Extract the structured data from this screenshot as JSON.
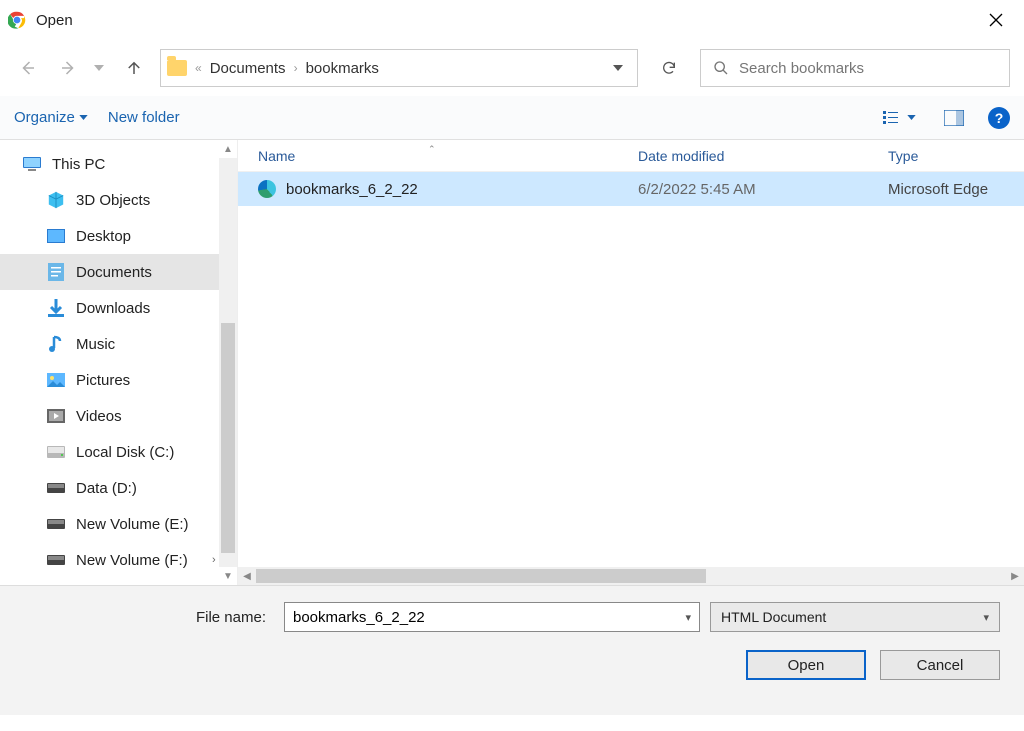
{
  "window": {
    "title": "Open"
  },
  "nav": {
    "segments": [
      "Documents",
      "bookmarks"
    ]
  },
  "search": {
    "placeholder": "Search bookmarks"
  },
  "toolbar": {
    "organize": "Organize",
    "new_folder": "New folder"
  },
  "sidebar": {
    "root": "This PC",
    "items": [
      {
        "label": "3D Objects",
        "icon": "cube"
      },
      {
        "label": "Desktop",
        "icon": "desktop"
      },
      {
        "label": "Documents",
        "icon": "doc",
        "selected": true
      },
      {
        "label": "Downloads",
        "icon": "download"
      },
      {
        "label": "Music",
        "icon": "music"
      },
      {
        "label": "Pictures",
        "icon": "pictures"
      },
      {
        "label": "Videos",
        "icon": "videos"
      },
      {
        "label": "Local Disk (C:)",
        "icon": "disk"
      },
      {
        "label": "Data (D:)",
        "icon": "disk"
      },
      {
        "label": "New Volume (E:)",
        "icon": "disk"
      },
      {
        "label": "New Volume (F:)",
        "icon": "disk",
        "expandable": true
      }
    ]
  },
  "columns": {
    "name": "Name",
    "date": "Date modified",
    "type": "Type"
  },
  "files": [
    {
      "name": "bookmarks_6_2_22",
      "date": "6/2/2022 5:45 AM",
      "type": "Microsoft Edge",
      "selected": true
    }
  ],
  "footer": {
    "file_name_label": "File name:",
    "file_name_value": "bookmarks_6_2_22",
    "file_type": "HTML Document",
    "open": "Open",
    "cancel": "Cancel"
  }
}
